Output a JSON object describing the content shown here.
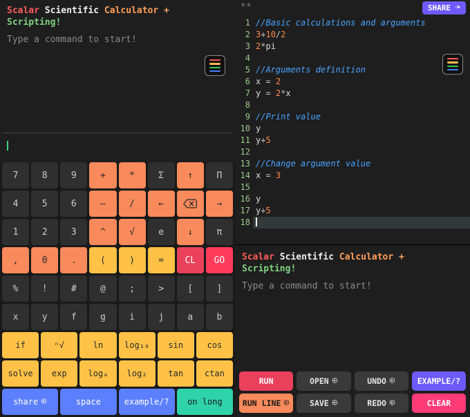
{
  "brand": {
    "scalar": "Scalar",
    "scientific": "Scientific",
    "calc": "Calculator + ",
    "scripting": "Scripting!"
  },
  "prompt": "Type a command to start!",
  "dirty_marker": "**",
  "share_label": "SHARE",
  "code_lines": [
    {
      "n": 1,
      "frags": [
        {
          "cls": "cmt",
          "t": "//Basic calculations and arguments"
        }
      ]
    },
    {
      "n": 2,
      "frags": [
        {
          "cls": "num",
          "t": "3"
        },
        {
          "cls": "op",
          "t": "+"
        },
        {
          "cls": "num",
          "t": "10"
        },
        {
          "cls": "op",
          "t": "/"
        },
        {
          "cls": "num",
          "t": "2"
        }
      ]
    },
    {
      "n": 3,
      "frags": [
        {
          "cls": "num",
          "t": "2"
        },
        {
          "cls": "op",
          "t": "*"
        },
        {
          "cls": "kw",
          "t": "pi"
        }
      ]
    },
    {
      "n": 4,
      "frags": []
    },
    {
      "n": 5,
      "frags": [
        {
          "cls": "cmt",
          "t": "//Arguments definition"
        }
      ]
    },
    {
      "n": 6,
      "frags": [
        {
          "cls": "var",
          "t": "x "
        },
        {
          "cls": "op",
          "t": "="
        },
        {
          "cls": "num",
          "t": " 2"
        }
      ]
    },
    {
      "n": 7,
      "frags": [
        {
          "cls": "var",
          "t": "y "
        },
        {
          "cls": "op",
          "t": "="
        },
        {
          "cls": "num",
          "t": " 2"
        },
        {
          "cls": "op",
          "t": "*"
        },
        {
          "cls": "var",
          "t": "x"
        }
      ]
    },
    {
      "n": 8,
      "frags": []
    },
    {
      "n": 9,
      "frags": [
        {
          "cls": "cmt",
          "t": "//Print value"
        }
      ]
    },
    {
      "n": 10,
      "frags": [
        {
          "cls": "var",
          "t": "y"
        }
      ]
    },
    {
      "n": 11,
      "frags": [
        {
          "cls": "var",
          "t": "y"
        },
        {
          "cls": "op",
          "t": "+"
        },
        {
          "cls": "num",
          "t": "5"
        }
      ]
    },
    {
      "n": 12,
      "frags": []
    },
    {
      "n": 13,
      "frags": [
        {
          "cls": "cmt",
          "t": "//Change argument value"
        }
      ]
    },
    {
      "n": 14,
      "frags": [
        {
          "cls": "var",
          "t": "x "
        },
        {
          "cls": "op",
          "t": "="
        },
        {
          "cls": "num",
          "t": " 3"
        }
      ]
    },
    {
      "n": 15,
      "frags": []
    },
    {
      "n": 16,
      "frags": [
        {
          "cls": "var",
          "t": "y"
        }
      ]
    },
    {
      "n": 17,
      "frags": [
        {
          "cls": "var",
          "t": "y"
        },
        {
          "cls": "op",
          "t": "+"
        },
        {
          "cls": "num",
          "t": "5"
        }
      ]
    },
    {
      "n": 18,
      "frags": []
    }
  ],
  "highlight_line": 18,
  "keypad": {
    "rows": [
      [
        {
          "l": "7",
          "c": "k-dark"
        },
        {
          "l": "8",
          "c": "k-dark"
        },
        {
          "l": "9",
          "c": "k-dark"
        },
        {
          "l": "+",
          "c": "k-or"
        },
        {
          "l": "*",
          "c": "k-or"
        },
        {
          "l": "Σ",
          "c": "k-dark"
        },
        {
          "l": "↑",
          "c": "k-or"
        },
        {
          "l": "Π",
          "c": "k-dark"
        }
      ],
      [
        {
          "l": "4",
          "c": "k-dark"
        },
        {
          "l": "5",
          "c": "k-dark"
        },
        {
          "l": "6",
          "c": "k-dark"
        },
        {
          "l": "–",
          "c": "k-or"
        },
        {
          "l": "/",
          "c": "k-or"
        },
        {
          "l": "←",
          "c": "k-or"
        },
        {
          "l": "⌫",
          "c": "k-or",
          "icon": "backspace"
        },
        {
          "l": "→",
          "c": "k-or"
        }
      ],
      [
        {
          "l": "1",
          "c": "k-dark"
        },
        {
          "l": "2",
          "c": "k-dark"
        },
        {
          "l": "3",
          "c": "k-dark"
        },
        {
          "l": "^",
          "c": "k-or"
        },
        {
          "l": "√",
          "c": "k-or"
        },
        {
          "l": "e",
          "c": "k-dark"
        },
        {
          "l": "↓",
          "c": "k-or"
        },
        {
          "l": "π",
          "c": "k-dark"
        }
      ],
      [
        {
          "l": ",",
          "c": "k-or"
        },
        {
          "l": "0",
          "c": "k-or"
        },
        {
          "l": ".",
          "c": "k-or"
        },
        {
          "l": "(",
          "c": "k-yel"
        },
        {
          "l": ")",
          "c": "k-yel"
        },
        {
          "l": "=",
          "c": "k-yel"
        },
        {
          "l": "CL",
          "c": "k-red"
        },
        {
          "l": "GO",
          "c": "k-red2"
        }
      ],
      [
        {
          "l": "%",
          "c": "k-dark"
        },
        {
          "l": "!",
          "c": "k-dark"
        },
        {
          "l": "#",
          "c": "k-dark"
        },
        {
          "l": "@",
          "c": "k-dark"
        },
        {
          "l": ";",
          "c": "k-dark"
        },
        {
          "l": ">",
          "c": "k-dark"
        },
        {
          "l": "[",
          "c": "k-dark"
        },
        {
          "l": "]",
          "c": "k-dark"
        }
      ],
      [
        {
          "l": "x",
          "c": "k-dark"
        },
        {
          "l": "y",
          "c": "k-dark"
        },
        {
          "l": "f",
          "c": "k-dark"
        },
        {
          "l": "g",
          "c": "k-dark"
        },
        {
          "l": "i",
          "c": "k-dark"
        },
        {
          "l": "j",
          "c": "k-dark"
        },
        {
          "l": "a",
          "c": "k-dark"
        },
        {
          "l": "b",
          "c": "k-dark"
        }
      ]
    ],
    "func_rows": [
      [
        {
          "l": "if",
          "c": "k-yel"
        },
        {
          "l": "ⁿ√",
          "c": "k-yel"
        },
        {
          "l": "ln",
          "c": "k-yel"
        },
        {
          "l": "log₁₀",
          "c": "k-yel"
        },
        {
          "l": "sin",
          "c": "k-yel"
        },
        {
          "l": "cos",
          "c": "k-yel"
        }
      ],
      [
        {
          "l": "solve",
          "c": "k-yel"
        },
        {
          "l": "exp",
          "c": "k-yel"
        },
        {
          "l": "logₐ",
          "c": "k-yel"
        },
        {
          "l": "log₂",
          "c": "k-yel"
        },
        {
          "l": "tan",
          "c": "k-yel"
        },
        {
          "l": "ctan",
          "c": "k-yel"
        }
      ]
    ],
    "bottom_row": [
      {
        "l": "share",
        "c": "k-blue",
        "gear": true
      },
      {
        "l": "space",
        "c": "k-blue"
      },
      {
        "l": "example/?",
        "c": "k-blue"
      },
      {
        "l": "on long",
        "c": "k-teal"
      }
    ]
  },
  "actions": {
    "row1": [
      {
        "l": "RUN",
        "c": "a-red"
      },
      {
        "l": "OPEN",
        "c": "",
        "gear": true
      },
      {
        "l": "UNDO",
        "c": "",
        "gear": true
      },
      {
        "l": "EXAMPLE/?",
        "c": "a-blue"
      }
    ],
    "row2": [
      {
        "l": "RUN LINE",
        "c": "a-or",
        "gear": true
      },
      {
        "l": "SAVE",
        "c": "",
        "gear": true
      },
      {
        "l": "REDO",
        "c": "",
        "gear": true
      },
      {
        "l": "CLEAR",
        "c": "a-pink"
      }
    ]
  }
}
